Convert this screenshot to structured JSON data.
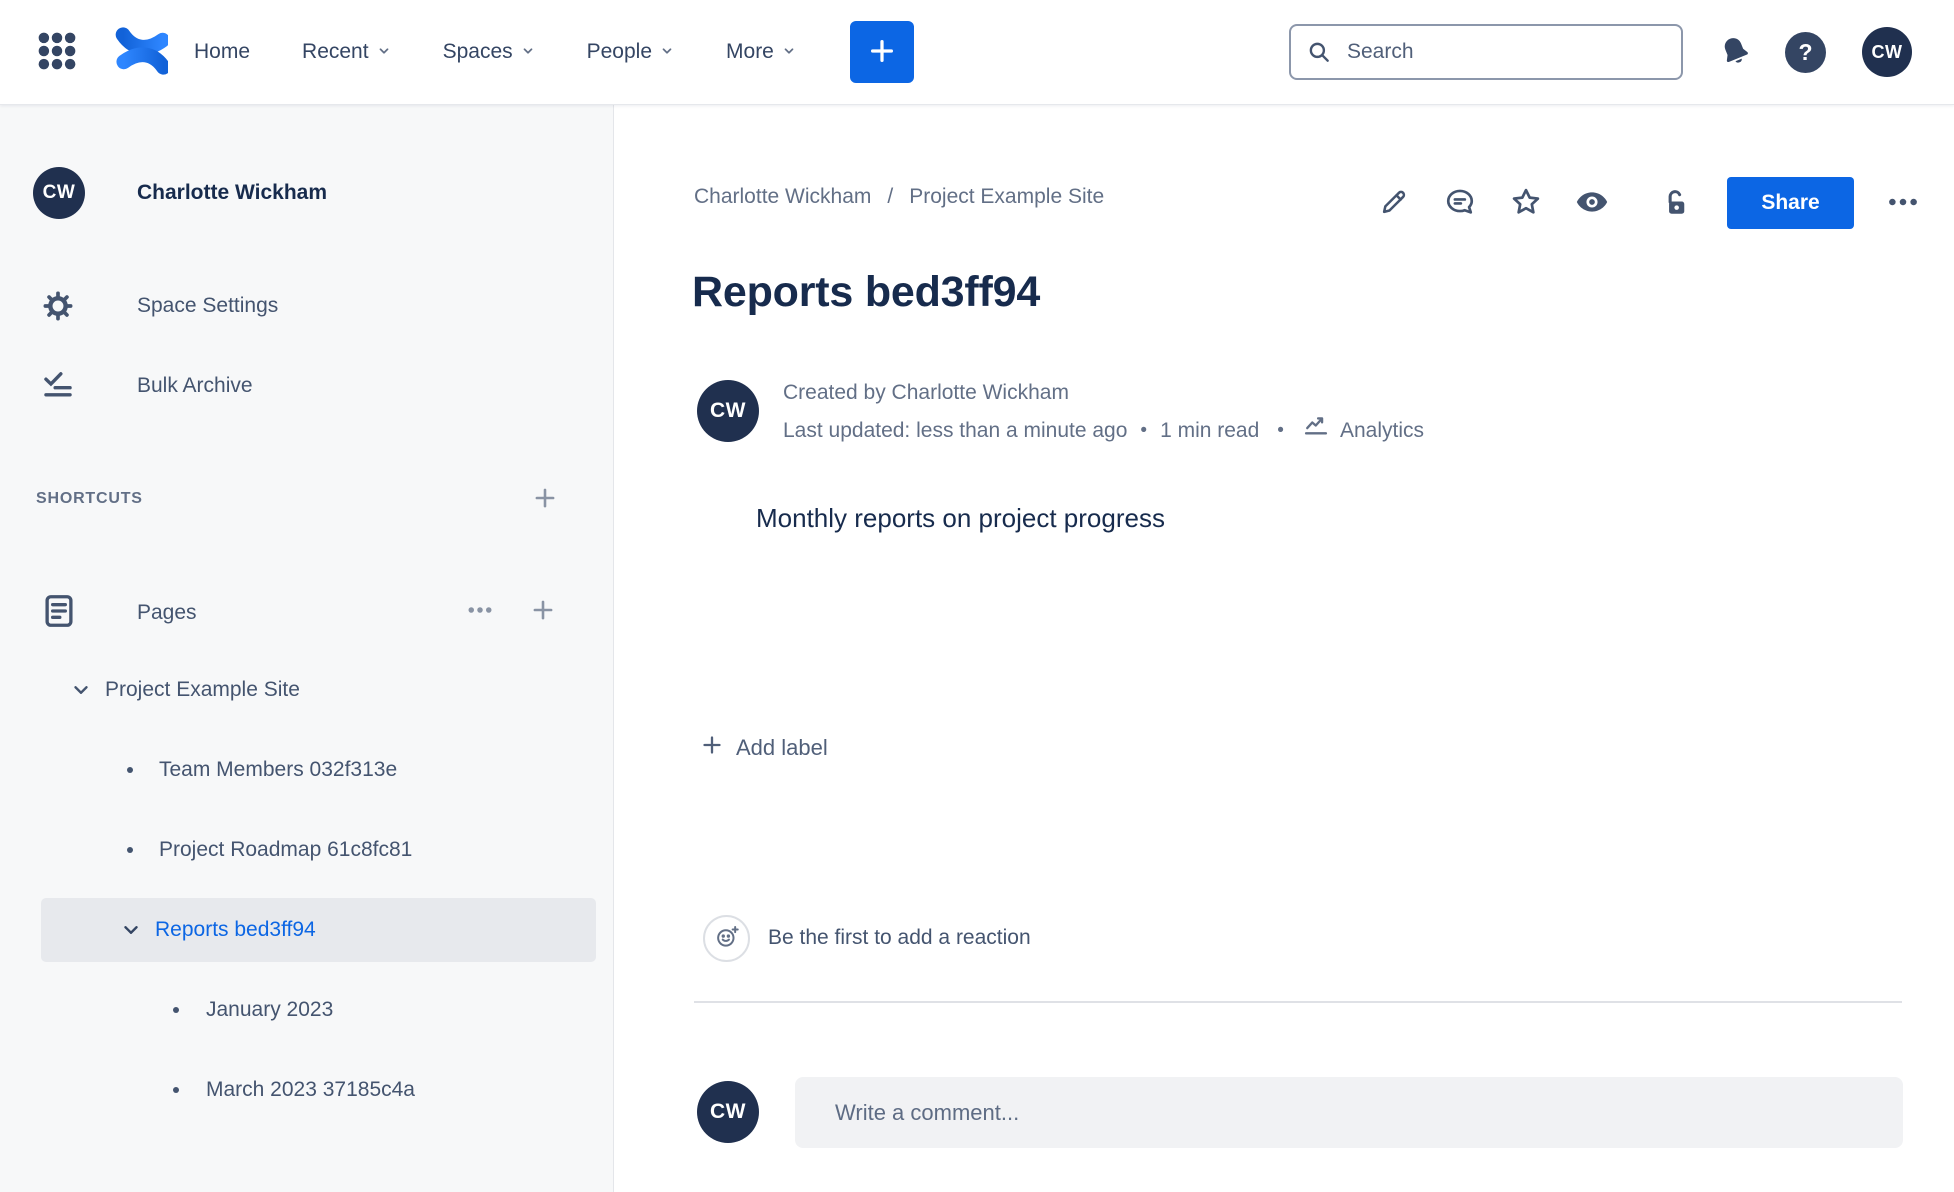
{
  "nav": {
    "links": [
      {
        "label": "Home",
        "dropdown": false
      },
      {
        "label": "Recent",
        "dropdown": true
      },
      {
        "label": "Spaces",
        "dropdown": true
      },
      {
        "label": "People",
        "dropdown": true
      },
      {
        "label": "More",
        "dropdown": true
      }
    ],
    "search_placeholder": "Search",
    "help_glyph": "?"
  },
  "user": {
    "initials": "CW",
    "name": "Charlotte Wickham"
  },
  "sidebar": {
    "space_name": "Charlotte Wickham",
    "settings_label": "Space Settings",
    "bulk_archive_label": "Bulk Archive",
    "shortcuts_label": "SHORTCUTS",
    "pages_label": "Pages",
    "tree": [
      {
        "label": "Project Example Site",
        "level": 0,
        "expanded": true,
        "selected": false
      },
      {
        "label": "Team Members 032f313e",
        "level": 1,
        "selected": false
      },
      {
        "label": "Project Roadmap 61c8fc81",
        "level": 1,
        "selected": false
      },
      {
        "label": "Reports bed3ff94",
        "level": 1,
        "expanded": true,
        "selected": true
      },
      {
        "label": "January 2023",
        "level": 2,
        "selected": false
      },
      {
        "label": "March 2023 37185c4a",
        "level": 2,
        "selected": false
      }
    ]
  },
  "page": {
    "breadcrumb": [
      "Charlotte Wickham",
      "Project Example Site"
    ],
    "breadcrumb_separator": "/",
    "share_label": "Share",
    "title": "Reports bed3ff94",
    "created_by": "Created by Charlotte Wickham",
    "last_updated": "Last updated: less than a minute ago",
    "read_time": "1 min read",
    "separator_dot": "•",
    "analytics_label": "Analytics",
    "body_text": "Monthly reports on project progress",
    "add_label_text": "Add label",
    "reaction_hint": "Be the first to add a reaction",
    "comment_placeholder": "Write a comment..."
  },
  "colors": {
    "accent_blue": "#0C66E4",
    "navy_text": "#172B4D",
    "gray_text": "#626F86",
    "avatar_bg": "#20304F",
    "sidebar_bg": "#F7F8F9",
    "selected_row_bg": "#E7E9ED"
  }
}
